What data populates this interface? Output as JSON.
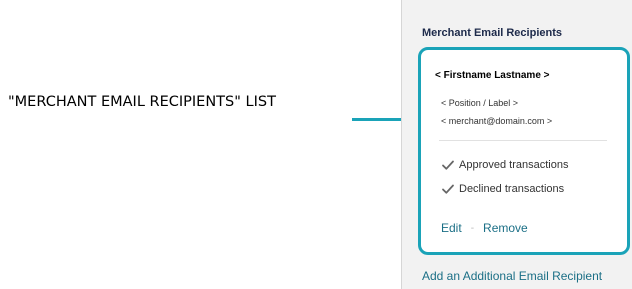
{
  "callout": {
    "label": "\"MERCHANT EMAIL RECIPIENTS\" LIST",
    "accent_color": "#1aa3b8"
  },
  "panel": {
    "title": "Merchant Email Recipients",
    "recipient": {
      "name": "< Firstname Lastname >",
      "position": "< Position / Label >",
      "email": "< merchant@domain.com >",
      "options": [
        {
          "label": "Approved transactions",
          "checked": true,
          "icon": "checkmark-icon"
        },
        {
          "label": "Declined transactions",
          "checked": true,
          "icon": "checkmark-icon"
        }
      ],
      "edit_label": "Edit",
      "separator": "-",
      "remove_label": "Remove"
    },
    "add_recipient_label": "Add an Additional Email Recipient"
  }
}
